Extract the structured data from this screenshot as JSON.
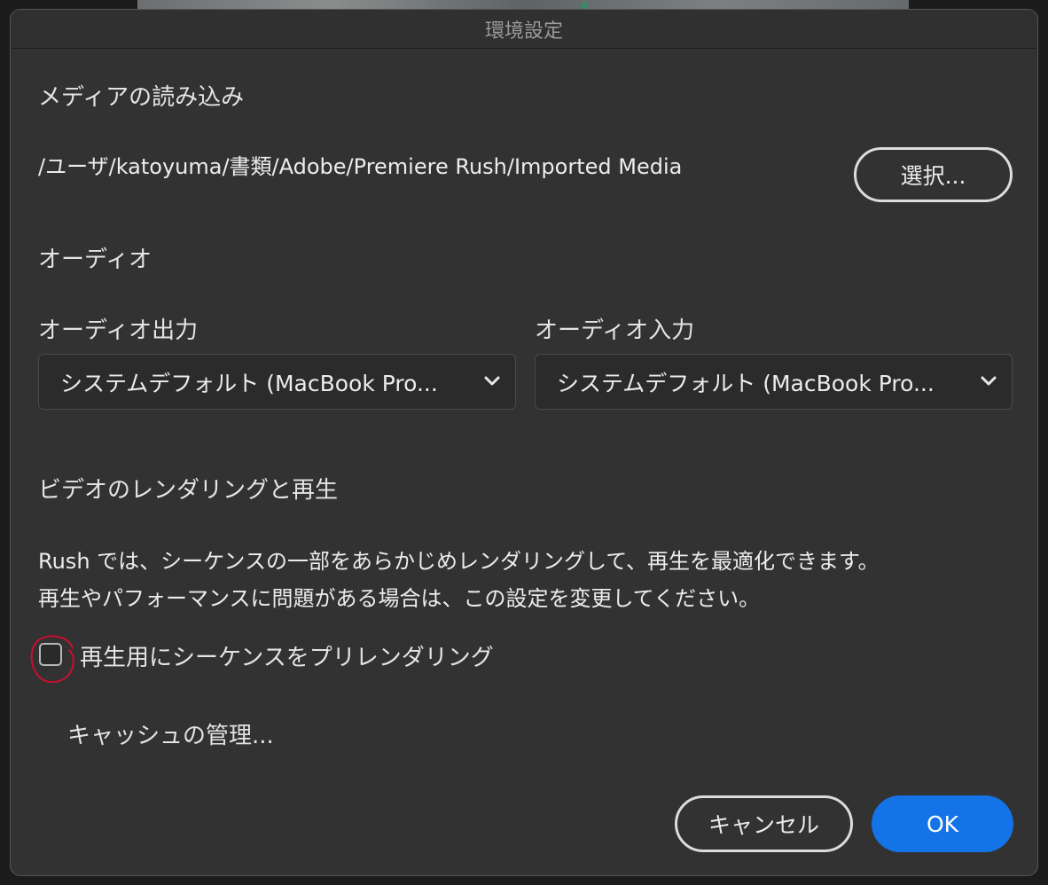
{
  "window": {
    "title": "環境設定"
  },
  "media_import": {
    "heading": "メディアの読み込み",
    "path": "/ユーザ/katoyuma/書類/Adobe/Premiere Rush/Imported Media",
    "choose_button": "選択..."
  },
  "audio": {
    "heading": "オーディオ",
    "output_label": "オーディオ出力",
    "output_value": "システムデフォルト (MacBook Pro...",
    "input_label": "オーディオ入力",
    "input_value": "システムデフォルト (MacBook Pro..."
  },
  "video": {
    "heading": "ビデオのレンダリングと再生",
    "description_line1": "Rush では、シーケンスの一部をあらかじめレンダリングして、再生を最適化できます。",
    "description_line2": "再生やパフォーマンスに問題がある場合は、この設定を変更してください。",
    "prerender_label": "再生用にシーケンスをプリレンダリング",
    "prerender_checked": false,
    "cache_button": "キャッシュの管理..."
  },
  "footer": {
    "cancel_button": "キャンセル",
    "ok_button": "OK"
  },
  "colors": {
    "dialog_bg": "#323232",
    "accent": "#1473e6",
    "annotation": "#c8102e"
  },
  "icons": {
    "dropdown": "chevron-down-icon"
  }
}
